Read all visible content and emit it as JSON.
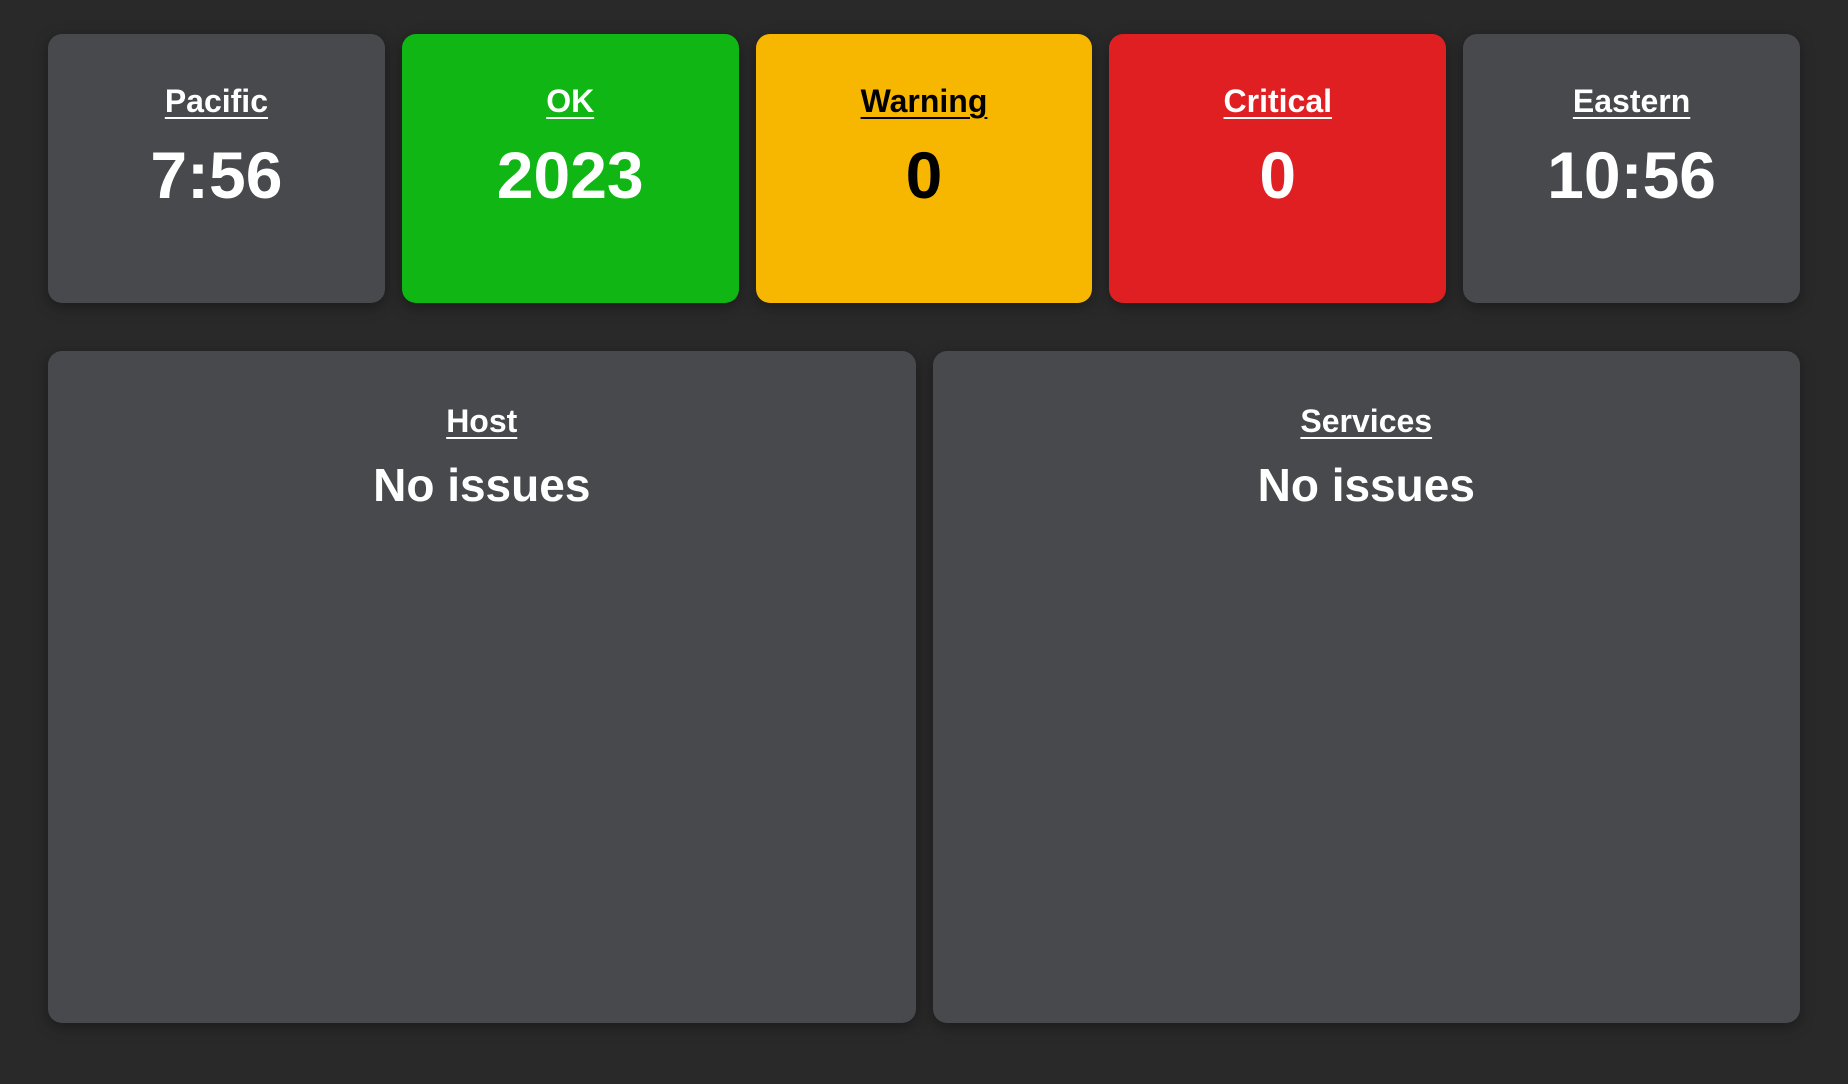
{
  "colors": {
    "background": "#292929",
    "tile_neutral": "#48494d",
    "ok": "#10b613",
    "warning": "#f7b701",
    "critical": "#e01f22"
  },
  "tiles": {
    "pacific": {
      "label": "Pacific",
      "value": "7:56"
    },
    "ok": {
      "label": "OK",
      "value": "2023"
    },
    "warning": {
      "label": "Warning",
      "value": "0"
    },
    "critical": {
      "label": "Critical",
      "value": "0"
    },
    "eastern": {
      "label": "Eastern",
      "value": "10:56"
    }
  },
  "panels": {
    "host": {
      "label": "Host",
      "status": "No issues"
    },
    "services": {
      "label": "Services",
      "status": "No issues"
    }
  }
}
